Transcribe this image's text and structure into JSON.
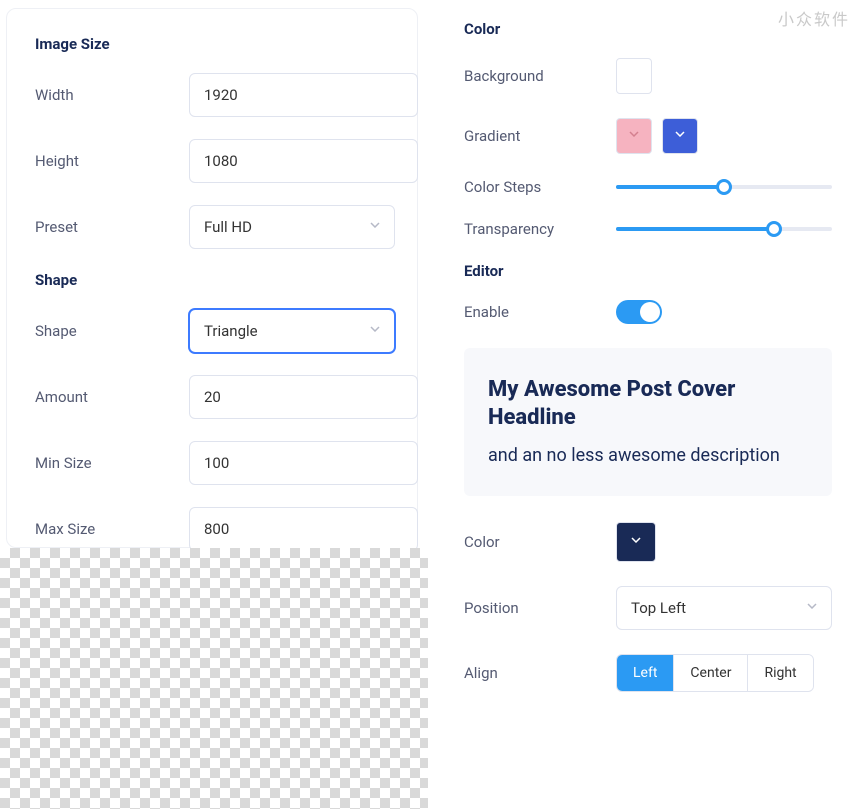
{
  "watermark": "小众软件",
  "imageSize": {
    "heading": "Image Size",
    "widthLabel": "Width",
    "widthValue": "1920",
    "heightLabel": "Height",
    "heightValue": "1080",
    "presetLabel": "Preset",
    "presetValue": "Full HD"
  },
  "shape": {
    "heading": "Shape",
    "shapeLabel": "Shape",
    "shapeValue": "Triangle",
    "amountLabel": "Amount",
    "amountValue": "20",
    "minSizeLabel": "Min Size",
    "minSizeValue": "100",
    "maxSizeLabel": "Max Size",
    "maxSizeValue": "800"
  },
  "color": {
    "heading": "Color",
    "backgroundLabel": "Background",
    "backgroundValue": "#ffffff",
    "gradientLabel": "Gradient",
    "gradientColors": [
      "#f6b3c0",
      "#3d5ed8"
    ],
    "colorStepsLabel": "Color Steps",
    "colorStepsPercent": 50,
    "transparencyLabel": "Transparency",
    "transparencyPercent": 73
  },
  "editor": {
    "heading": "Editor",
    "enableLabel": "Enable",
    "enableValue": true,
    "previewTitle": "My Awesome Post Cover Headline",
    "previewDesc": "and an no less awesome description",
    "colorLabel": "Color",
    "colorValue": "#192a56",
    "positionLabel": "Position",
    "positionValue": "Top Left",
    "alignLabel": "Align",
    "alignOptions": [
      "Left",
      "Center",
      "Right"
    ],
    "alignSelected": "Left"
  }
}
